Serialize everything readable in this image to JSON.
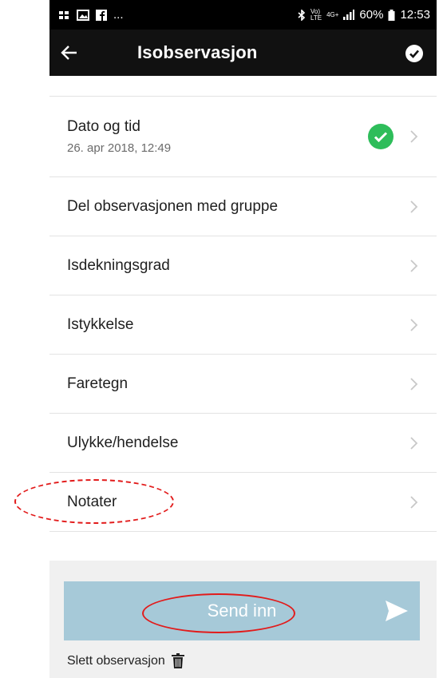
{
  "statusbar": {
    "carrier_icons": "...",
    "volte": "Vo)",
    "lte": "LTE",
    "net": "4G+",
    "battery": "60%",
    "time": "12:53"
  },
  "appbar": {
    "title": "Isobservasjon"
  },
  "list": {
    "rows": [
      {
        "label": "Dato og tid",
        "sub": "26. apr 2018, 12:49"
      },
      {
        "label": "Del observasjonen med gruppe"
      },
      {
        "label": "Isdekningsgrad"
      },
      {
        "label": "Istykkelse"
      },
      {
        "label": "Faretegn"
      },
      {
        "label": "Ulykke/hendelse"
      },
      {
        "label": "Notater"
      }
    ]
  },
  "actions": {
    "send_label": "Send inn",
    "delete_label": "Slett observasjon"
  },
  "colors": {
    "send_button": "#a6c9d8",
    "ok_green": "#2ebd5a",
    "annotation_red": "#e21b1b"
  },
  "icons": [
    "back-arrow-icon",
    "check-circle-icon",
    "check-green-icon",
    "chevron-right-icon",
    "send-icon",
    "trash-icon",
    "bluetooth-icon",
    "signal-icon",
    "battery-icon"
  ]
}
